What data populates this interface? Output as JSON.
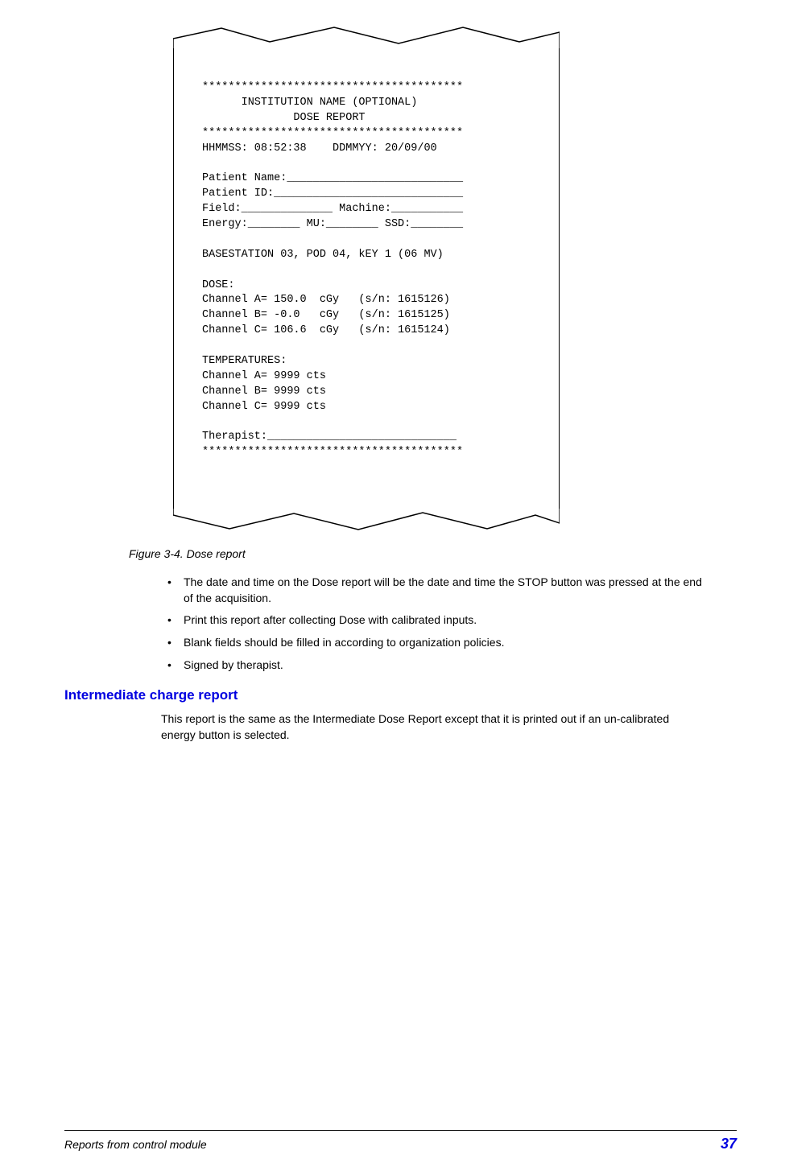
{
  "receipt": {
    "sep": "****************************************",
    "title1": "      INSTITUTION NAME (OPTIONAL)",
    "title2": "              DOSE REPORT",
    "time_line": "HHMMSS: 08:52:38    DDMMYY: 20/09/00",
    "patient_name": "Patient Name:___________________________",
    "patient_id": "Patient ID:_____________________________",
    "field_line": "Field:______________ Machine:___________",
    "energy_line": "Energy:________ MU:________ SSD:________",
    "basestation": "BASESTATION 03, POD 04, kEY 1 (06 MV)",
    "dose_label": "DOSE:",
    "dose_a": "Channel A= 150.0  cGy   (s/n: 1615126)",
    "dose_b": "Channel B= -0.0   cGy   (s/n: 1615125)",
    "dose_c": "Channel C= 106.6  cGy   (s/n: 1615124)",
    "temp_label": "TEMPERATURES:",
    "temp_a": "Channel A= 9999 cts",
    "temp_b": "Channel B= 9999 cts",
    "temp_c": "Channel C= 9999 cts",
    "therapist": "Therapist:_____________________________"
  },
  "figure_caption": "Figure 3-4. Dose report",
  "bullets": {
    "b1": "The date and time on the Dose report will be the date and time the STOP button was pressed at the end of the acquisition.",
    "b2": "Print this report after collecting Dose with calibrated inputs.",
    "b3": "Blank fields should be filled in according to organization policies.",
    "b4": "Signed by therapist."
  },
  "section_heading": "Intermediate charge report",
  "section_para": "This report is the same as the Intermediate Dose Report except that it is printed out if an un-calibrated energy button is selected.",
  "footer": {
    "title": "Reports from control module",
    "page": "37"
  }
}
